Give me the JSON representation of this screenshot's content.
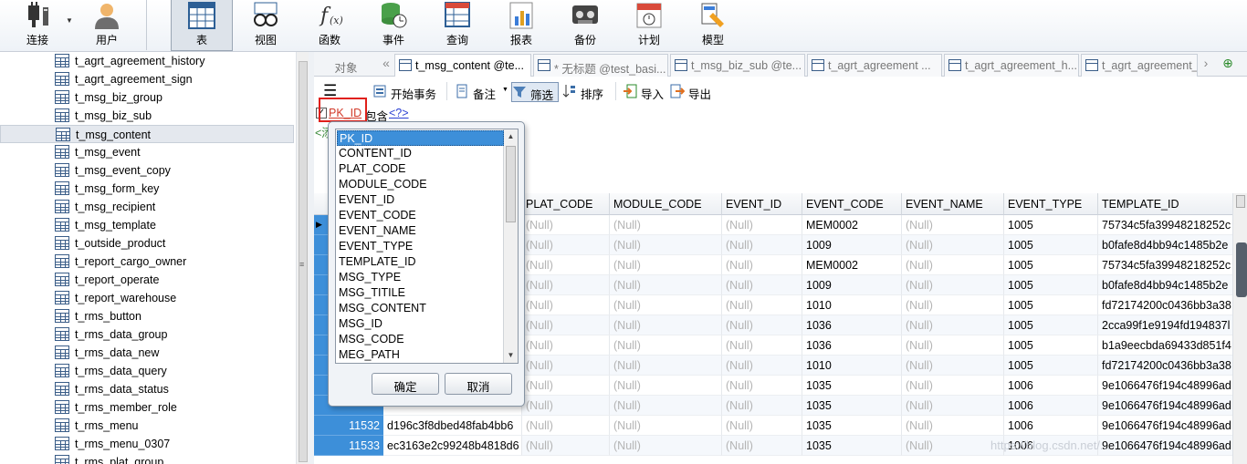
{
  "toolbar": {
    "connect": "连接",
    "user": "用户",
    "table": "表",
    "view": "视图",
    "function": "函数",
    "event": "事件",
    "query": "查询",
    "report": "报表",
    "backup": "备份",
    "schedule": "计划",
    "model": "模型"
  },
  "sidebar": {
    "tables": [
      "t_agrt_agreement_history",
      "t_agrt_agreement_sign",
      "t_msg_biz_group",
      "t_msg_biz_sub",
      "t_msg_content",
      "t_msg_event",
      "t_msg_event_copy",
      "t_msg_form_key",
      "t_msg_recipient",
      "t_msg_template",
      "t_outside_product",
      "t_report_cargo_owner",
      "t_report_operate",
      "t_report_warehouse",
      "t_rms_button",
      "t_rms_data_group",
      "t_rms_data_new",
      "t_rms_data_query",
      "t_rms_data_status",
      "t_rms_member_role",
      "t_rms_menu",
      "t_rms_menu_0307",
      "t_rms_plat_group"
    ],
    "selected": "t_msg_content"
  },
  "tabs": {
    "object": "对象",
    "items": [
      "t_msg_content @te...",
      "* 无标题 @test_basi...",
      "t_msg_biz_sub @te...",
      "t_agrt_agreement ...",
      "t_agrt_agreement_h...",
      "t_agrt_agreement_"
    ]
  },
  "actions": {
    "begin_transaction": "开始事务",
    "comment": "备注",
    "filter": "筛选",
    "sort": "排序",
    "import": "导入",
    "export": "导出"
  },
  "filter": {
    "field": "PK_ID",
    "operator": "包含",
    "value": "<?>",
    "add_hint": "<添"
  },
  "grid": {
    "columns": [
      "PLAT_CODE",
      "MODULE_CODE",
      "EVENT_ID",
      "EVENT_CODE",
      "EVENT_NAME",
      "EVENT_TYPE",
      "TEMPLATE_ID"
    ],
    "null_text": "(Null)",
    "rows": [
      {
        "num": "",
        "content": "",
        "event_code": "MEM0002",
        "event_type": "1005",
        "template": "75734c5fa39948218252c"
      },
      {
        "num": "",
        "content": "",
        "event_code": "1009",
        "event_type": "1005",
        "template": "b0fafe8d4bb94c1485b2e"
      },
      {
        "num": "",
        "content": "",
        "event_code": "MEM0002",
        "event_type": "1005",
        "template": "75734c5fa39948218252c"
      },
      {
        "num": "",
        "content": "",
        "event_code": "1009",
        "event_type": "1005",
        "template": "b0fafe8d4bb94c1485b2e"
      },
      {
        "num": "",
        "content": "",
        "event_code": "1010",
        "event_type": "1005",
        "template": "fd72174200c0436bb3a38"
      },
      {
        "num": "",
        "content": "",
        "event_code": "1036",
        "event_type": "1005",
        "template": "2cca99f1e9194fd194837l"
      },
      {
        "num": "",
        "content": "",
        "event_code": "1036",
        "event_type": "1005",
        "template": "b1a9eecbda69433d851f4"
      },
      {
        "num": "",
        "content": "",
        "event_code": "1010",
        "event_type": "1005",
        "template": "fd72174200c0436bb3a38"
      },
      {
        "num": "",
        "content": "",
        "event_code": "1035",
        "event_type": "1006",
        "template": "9e1066476f194c48996ad"
      },
      {
        "num": "",
        "content": "",
        "event_code": "1035",
        "event_type": "1006",
        "template": "9e1066476f194c48996ad"
      },
      {
        "num": "11532",
        "content": "d196c3f8dbed48fab4bb6",
        "event_code": "1035",
        "event_type": "1006",
        "template": "9e1066476f194c48996ad"
      },
      {
        "num": "11533",
        "content": "ec3163e2c99248b4818d6",
        "event_code": "1035",
        "event_type": "1006",
        "template": "9e1066476f194c48996ad"
      }
    ]
  },
  "popup": {
    "fields": [
      "PK_ID",
      "CONTENT_ID",
      "PLAT_CODE",
      "MODULE_CODE",
      "EVENT_ID",
      "EVENT_CODE",
      "EVENT_NAME",
      "EVENT_TYPE",
      "TEMPLATE_ID",
      "MSG_TYPE",
      "MSG_TITILE",
      "MSG_CONTENT",
      "MSG_ID",
      "MSG_CODE",
      "MEG_PATH"
    ],
    "selected": "PK_ID",
    "ok": "确定",
    "cancel": "取消"
  },
  "watermark": "https://blog.csdn.net/..."
}
